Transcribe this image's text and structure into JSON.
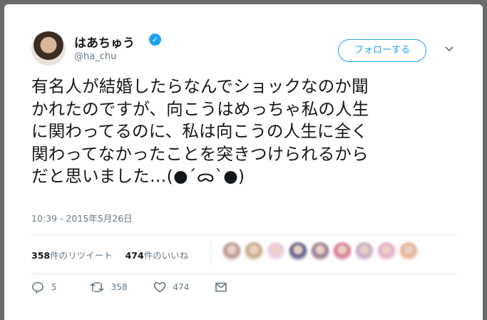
{
  "user": {
    "display_name": "はあちゅう",
    "handle": "@ha_chu",
    "verified": true
  },
  "follow_button": {
    "label": "フォローする"
  },
  "tweet": {
    "text": "有名人が結婚したらなんでショックなのか聞\nかれたのですが、向こうはめっちゃ私の人生\nに関わってるのに、私は向こうの人生に全く\n関わってなかったことを突きつけられるから\nだと思いました…(●´ᯅ`●)",
    "timestamp": "10:39 - 2015年5月26日"
  },
  "stats": {
    "retweets_count": "358",
    "retweets_label": "件のリツイート",
    "likes_count": "474",
    "likes_label": "件のいいね"
  },
  "likers": {
    "avatar_colors": [
      "#b08b86",
      "#c2a27a",
      "#efc8e8",
      "#4a4a78",
      "#8a6a84",
      "#d86a8a",
      "#bfa3c4",
      "#e6a3c6",
      "#e9a98a"
    ]
  },
  "actions": {
    "reply_count": "5",
    "retweet_count": "358",
    "like_count": "474"
  },
  "colors": {
    "accent": "#1da1f2",
    "muted_text": "#657786",
    "divider": "#e6ecf0"
  }
}
